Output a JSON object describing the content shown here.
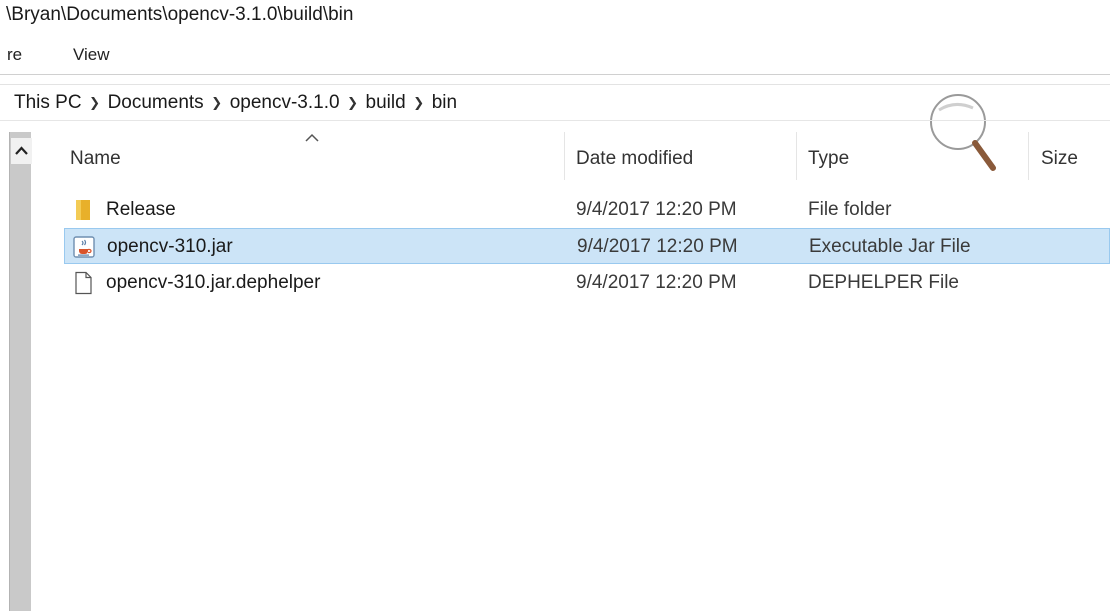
{
  "window": {
    "title_path": "\\Bryan\\Documents\\opencv-3.1.0\\build\\bin"
  },
  "ribbon": {
    "partial_tab": "re",
    "view_tab": "View"
  },
  "address_bar": {
    "crumbs": [
      "This PC",
      "Documents",
      "opencv-3.1.0",
      "build",
      "bin"
    ]
  },
  "columns": {
    "name": "Name",
    "date": "Date modified",
    "type": "Type",
    "size": "Size"
  },
  "files": [
    {
      "name": "Release",
      "date": "9/4/2017 12:20 PM",
      "type": "File folder",
      "icon": "folder-icon",
      "selected": false
    },
    {
      "name": "opencv-310.jar",
      "date": "9/4/2017 12:20 PM",
      "type": "Executable Jar File",
      "icon": "java-jar-icon",
      "selected": true
    },
    {
      "name": "opencv-310.jar.dephelper",
      "date": "9/4/2017 12:20 PM",
      "type": "DEPHELPER File",
      "icon": "document-icon",
      "selected": false
    }
  ],
  "colors": {
    "selection": "#cce4f7",
    "selection_border": "#99c9ef",
    "folder": "#e8b02a"
  }
}
